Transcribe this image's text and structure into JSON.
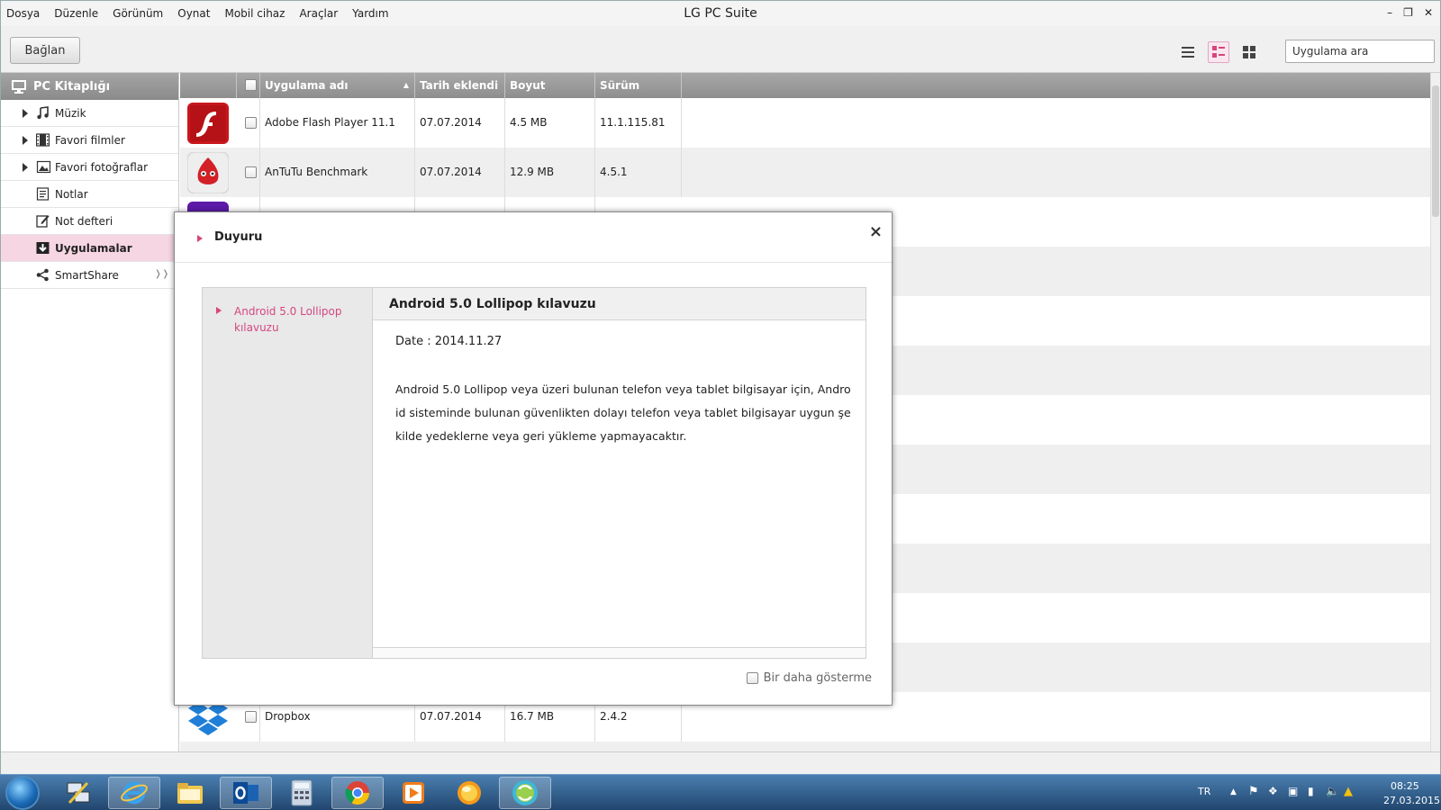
{
  "window": {
    "title": "LG PC Suite",
    "menus": [
      "Dosya",
      "Düzenle",
      "Görünüm",
      "Oynat",
      "Mobil cihaz",
      "Araçlar",
      "Yardım"
    ]
  },
  "toolbar": {
    "connect_label": "Bağlan",
    "search_placeholder": "Uygulama ara"
  },
  "sidebar": {
    "header": "PC Kitaplığı",
    "items": [
      {
        "label": "Müzik"
      },
      {
        "label": "Favori filmler"
      },
      {
        "label": "Favori fotoğraflar"
      },
      {
        "label": "Notlar"
      },
      {
        "label": "Not defteri"
      },
      {
        "label": "Uygulamalar"
      },
      {
        "label": "SmartShare"
      }
    ]
  },
  "table": {
    "columns": [
      "Uygulama adı",
      "Tarih eklendi",
      "Boyut",
      "Sürüm"
    ],
    "rows": [
      {
        "name": "Adobe Flash Player 11.1",
        "date": "07.07.2014",
        "size": "4.5 MB",
        "version": "11.1.115.81"
      },
      {
        "name": "AnTuTu Benchmark",
        "date": "07.07.2014",
        "size": "12.9 MB",
        "version": "4.5.1"
      },
      {
        "name": "Dropbox",
        "date": "07.07.2014",
        "size": "16.7 MB",
        "version": "2.4.2"
      }
    ]
  },
  "dialog": {
    "title": "Duyuru",
    "list_item": "Android 5.0 Lollipop kılavuzu",
    "panel_title": "Android 5.0 Lollipop kılavuzu",
    "date": "Date : 2014.11.27",
    "body": "Android 5.0 Lollipop veya üzeri bulunan telefon veya tablet bilgisayar için, Android sisteminde bulunan güvenlikten dolayı telefon veya tablet bilgisayar uygun şekilde yedeklerne veya geri yükleme yapmayacaktır.",
    "dont_show": "Bir daha gösterme"
  },
  "tray": {
    "lang": "TR",
    "time": "08:25",
    "date": "27.03.2015"
  },
  "colors": {
    "accent_pink": "#d6467c",
    "selected_bg": "#f6d6e2",
    "header_gray": "#999999"
  }
}
